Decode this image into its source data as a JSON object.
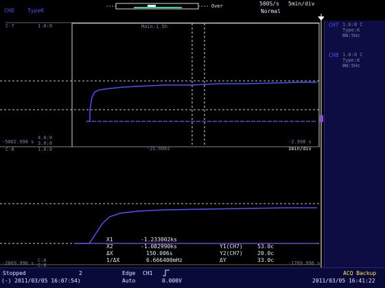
{
  "header": {
    "ch_label": "CH8",
    "type_label": "TypeK",
    "range_label": "Over",
    "sample_rate": "500S/s",
    "time_div": "5min/div",
    "mode": "Normal"
  },
  "channels_panel": [
    {
      "name": "CH7",
      "lines": [
        "1.0:0 C",
        "Type:K",
        "BW:5Hz"
      ]
    },
    {
      "name": "CH8",
      "lines": [
        "1.0:0 C",
        "Type:K",
        "BW:5Hz"
      ]
    }
  ],
  "upper_window": {
    "ch_tag": "C-7",
    "top_scale": "1.0:0",
    "title": "Main:1.5h",
    "bottom_scale_a": "4.0:0",
    "bottom_scale_b": "3.0:0",
    "left_time": "-5002.998 s",
    "right_time": "-2.998 s"
  },
  "lower_window": {
    "ch_tag": "C-8",
    "top_scale": "1.0:0",
    "zoom_title": "-21.00ks",
    "zoom_right": "1min/div",
    "bottom_scale_a": "C:0",
    "bottom_scale_b": "C:0",
    "left_time": "-2869.996 s",
    "right_time": "-1769.996 s"
  },
  "cursors": {
    "x1_label": "X1",
    "x1_value": "-1.233002ks",
    "x2_label": "X2",
    "x2_value": "-1.082990ks",
    "dx_label": "ΔX",
    "dx_value": "150.006s",
    "inv_dx_label": "1/ΔX",
    "inv_dx_value": "6.666400mHz",
    "y1_label": "Y1(CH7)",
    "y1_value": "53.0c",
    "y2_label": "Y2(CH7)",
    "y2_value": "20.0c",
    "dy_label": "ΔY",
    "dy_value": "33.0c"
  },
  "footer": {
    "status": "Stopped",
    "count": "2",
    "start_time": "(-) 2011/03/05 16:07:54)",
    "edge_label": "Edge",
    "edge_ch": "CH1",
    "auto_label": "Auto",
    "level": "0.000V",
    "acq": "ACQ Backup",
    "end_time": "2011/03/05 16:41:22"
  },
  "colors": {
    "trace": "#5050ff",
    "trace_dim": "#8a4ad8",
    "panel_bg": "#0d0d44",
    "grid_dash": "#cfcfcf",
    "accent_yellow": "#ffe84a"
  }
}
